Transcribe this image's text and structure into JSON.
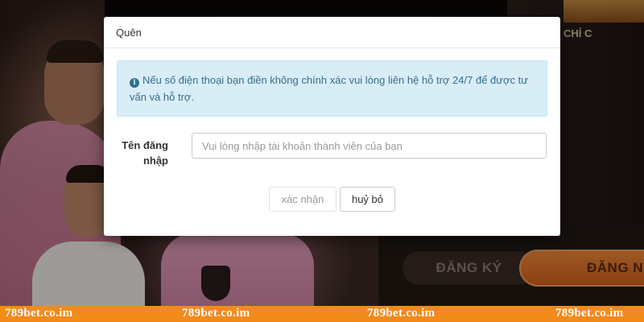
{
  "background": {
    "brand_tagline": "CHỈ C",
    "register_button": "ĐĂNG KÝ",
    "login_button": "ĐĂNG N"
  },
  "modal": {
    "title": "Quên",
    "alert": {
      "icon": "info-icon",
      "text": "Nếu số điện thoại bạn điền không chính xác vui lòng liên hệ hỗ trợ 24/7 để được tư vấn và hỗ trợ."
    },
    "form": {
      "username_label": "Tên đăng nhập",
      "username_placeholder": "Vui lòng nhập tài khoản thành viên của bạn",
      "username_value": ""
    },
    "buttons": {
      "confirm": "xác nhận",
      "cancel": "huỷ bỏ"
    }
  },
  "watermark": [
    "789bet.co.im",
    "789bet.co.im",
    "789bet.co.im",
    "789bet.co.im"
  ],
  "colors": {
    "alert_bg": "#d9edf7",
    "alert_text": "#31708f",
    "accent_orange": "#f28a1c"
  }
}
